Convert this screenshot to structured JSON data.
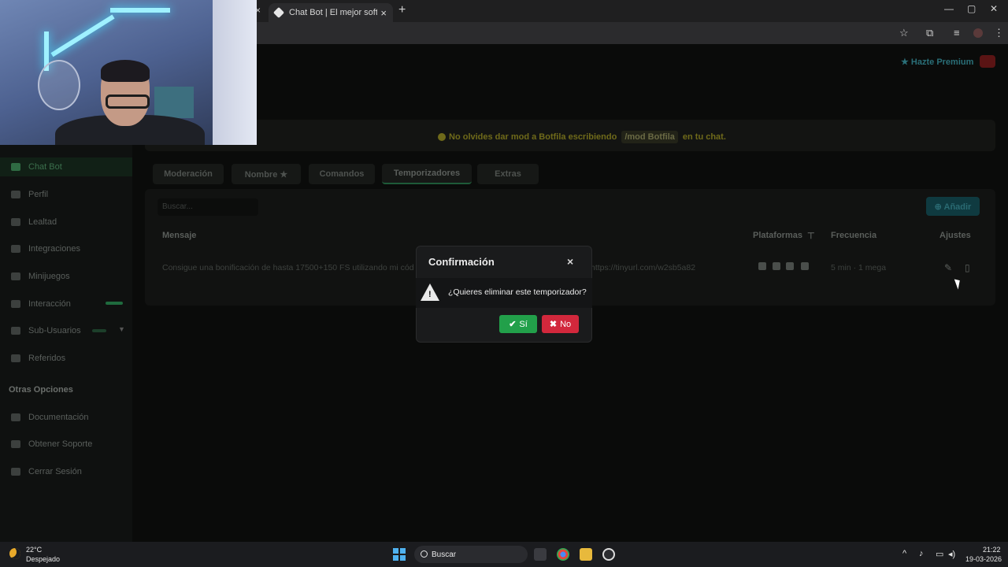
{
  "browser": {
    "tab_title": "Chat Bot | El mejor software pa",
    "close_glyph": "×",
    "new_tab_glyph": "+",
    "win_min": "—",
    "win_max": "▢",
    "win_close": "✕"
  },
  "header": {
    "premium_label": "★ Hazte Premium"
  },
  "sidebar": {
    "items": [
      {
        "label": "Chat Bot"
      },
      {
        "label": "Perfil"
      },
      {
        "label": "Lealtad"
      },
      {
        "label": "Integraciones"
      },
      {
        "label": "Minijuegos"
      },
      {
        "label": "Interacción"
      },
      {
        "label": "Sub-Usuarios"
      },
      {
        "label": "Referidos"
      }
    ],
    "other_heading": "Otras Opciones",
    "other_items": [
      {
        "label": "Documentación"
      },
      {
        "label": "Obtener Soporte"
      },
      {
        "label": "Cerrar Sesión"
      }
    ]
  },
  "notice": {
    "before": "No olvides dar mod a Botfila escribiendo",
    "code": "/mod Botfila",
    "after": "en tu chat."
  },
  "tabs": [
    {
      "label": "Moderación"
    },
    {
      "label": "Nombre ★"
    },
    {
      "label": "Comandos"
    },
    {
      "label": "Temporizadores"
    },
    {
      "label": "Extras"
    }
  ],
  "table": {
    "search_placeholder": "Buscar...",
    "add_label": "⊕ Añadir",
    "headers": {
      "message": "Mensaje",
      "platforms": "Plataformas",
      "frequency": "Frecuencia",
      "settings": "Ajustes"
    },
    "rows": [
      {
        "message": "Consigue una bonificación de hasta 17500+150 FS utilizando mi cód",
        "link": "https://tinyurl.com/w2sb5a82",
        "frequency": "5 min · 1 mega"
      }
    ]
  },
  "modal": {
    "title": "Confirmación",
    "close": "×",
    "question": "¿Quieres eliminar este temporizador?",
    "yes_label": "Sí",
    "no_label": "No",
    "yes_color": "#22a04a",
    "no_color": "#d2283c"
  },
  "taskbar": {
    "temp": "22°C",
    "weather": "Despejado",
    "search_label": "Buscar",
    "time": "21:22",
    "date": "19-03-2026"
  },
  "icons": [
    "star-icon",
    "extensions-icon",
    "warning-icon",
    "check-icon",
    "close-icon",
    "edit-icon",
    "trash-icon"
  ]
}
